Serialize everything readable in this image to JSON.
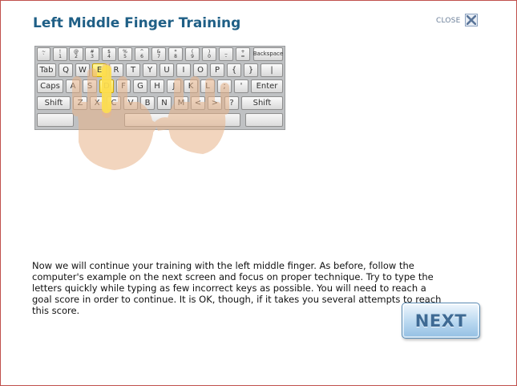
{
  "dialog": {
    "title": "Left Middle Finger Training",
    "close_label": "CLOSE",
    "instructions": "Now we will continue your training with the left middle finger. As before, follow the computer's example on the next screen and focus on proper technique. Try to type the letters quickly while typing as few incorrect keys as possible. You will need to reach a goal score in order to continue. It is OK, though, if it takes you several attempts to reach this score.",
    "next_label": "NEXT"
  },
  "keyboard": {
    "number_row": [
      {
        "top": "~",
        "bottom": "`"
      },
      {
        "top": "!",
        "bottom": "1"
      },
      {
        "top": "@",
        "bottom": "2"
      },
      {
        "top": "#",
        "bottom": "3"
      },
      {
        "top": "$",
        "bottom": "4"
      },
      {
        "top": "%",
        "bottom": "5"
      },
      {
        "top": "^",
        "bottom": "6"
      },
      {
        "top": "&",
        "bottom": "7"
      },
      {
        "top": "*",
        "bottom": "8"
      },
      {
        "top": "(",
        "bottom": "9"
      },
      {
        "top": ")",
        "bottom": "0"
      },
      {
        "top": "_",
        "bottom": "-"
      },
      {
        "top": "+",
        "bottom": "="
      }
    ],
    "backspace": "Backspace",
    "tab": "Tab",
    "top_row": [
      "Q",
      "W",
      "E",
      "R",
      "T",
      "Y",
      "U",
      "I",
      "O",
      "P",
      "{",
      "}",
      "|"
    ],
    "caps": "Caps",
    "home_row": [
      "A",
      "S",
      "D",
      "F",
      "G",
      "H",
      "J",
      "K",
      "L",
      ";",
      "'"
    ],
    "enter": "Enter",
    "shift_left": "Shift",
    "bottom_row": [
      "Z",
      "X",
      "C",
      "V",
      "B",
      "N",
      "M",
      "<",
      ">",
      "?"
    ],
    "shift_right": "Shift",
    "highlighted_keys": [
      "E",
      "D"
    ],
    "highlight_color": "#ffe24a"
  },
  "colors": {
    "title": "#1f5f86",
    "frame_border": "#c0504d",
    "hand": "#e8b48a",
    "next_text": "#3e6a94"
  }
}
